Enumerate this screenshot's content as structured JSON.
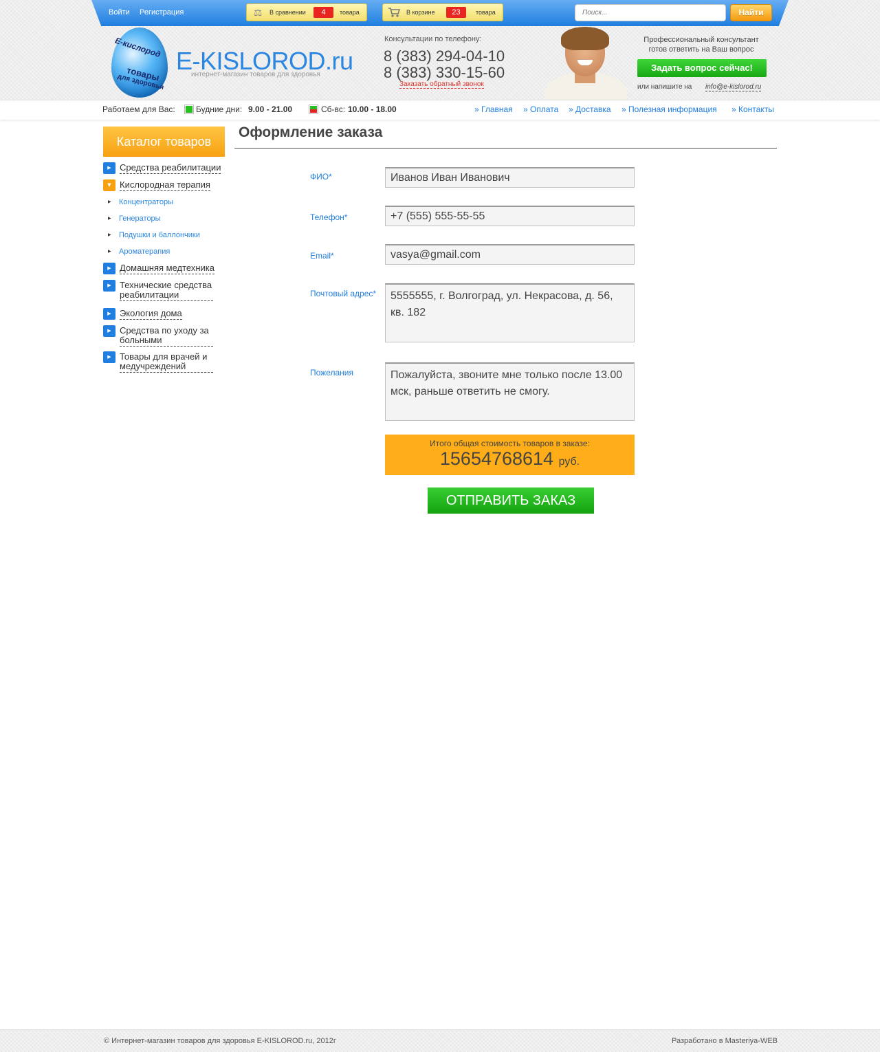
{
  "topbar": {
    "login": "Войти",
    "register": "Регистрация",
    "compare": {
      "label": "В сравнении",
      "count": "4",
      "suffix": "товара",
      "icon": "scales-icon"
    },
    "cart": {
      "label": "В корзине",
      "count": "23",
      "suffix": "товара",
      "icon": "cart-icon"
    },
    "search_placeholder": "Поиск...",
    "search_button": "Найти"
  },
  "header": {
    "logo": {
      "line1": "E-кислород",
      "line2": "товары",
      "line3": "для здоровья"
    },
    "brand": "E-KISLOROD.ru",
    "tagline": "интернет-магазин товаров для здоровья",
    "consult_title": "Консультации по телефону:",
    "phones": [
      "8 (383) 294-04-10",
      "8 (383) 330-15-60"
    ],
    "callback": "Заказать обратный звонок",
    "pro_line1": "Профессиональный консультант",
    "pro_line2": "готов ответить на Ваш вопрос",
    "ask_button": "Задать вопрос сейчас!",
    "write_label": "или напишите на",
    "email": "info@e-kislorod.ru"
  },
  "strip": {
    "working_label": "Работаем для Вас:",
    "weekdays_label": "Будние дни:",
    "weekdays_hours": "9.00 - 21.00",
    "weekend_label": "Сб-вс:",
    "weekend_hours": "10.00 - 18.00",
    "nav": [
      "» Главная",
      "» Оплата",
      "» Доставка",
      "» Полезная информация",
      "» Контакты"
    ]
  },
  "sidebar": {
    "title": "Каталог товаров",
    "items": [
      {
        "label": "Средства реабилитации"
      },
      {
        "label": "Кислородная терапия"
      },
      {
        "label": "Домашняя медтехника"
      },
      {
        "label": "Технические средства реабилитации"
      },
      {
        "label": "Экология дома"
      },
      {
        "label": "Средства по уходу за больными"
      },
      {
        "label": "Товары для врачей и медучреждений"
      }
    ],
    "subitems": [
      "Концентраторы",
      "Генераторы",
      "Подушки и баллончики",
      "Ароматерапия"
    ]
  },
  "main": {
    "title": "Оформление заказа",
    "fields": {
      "name": {
        "label": "ФИО*",
        "value": "Иванов Иван Иванович"
      },
      "phone": {
        "label": "Телефон*",
        "value": "+7 (555) 555-55-55"
      },
      "email": {
        "label": "Email*",
        "value": "vasya@gmail.com"
      },
      "address": {
        "label": "Почтовый адрес*",
        "value": "5555555, г. Волгоград, ул. Некрасова, д. 56, кв. 182"
      },
      "wishes": {
        "label": "Пожелания",
        "value": "Пожалуйста, звоните мне только после 13.00 мск, раньше ответить не смогу."
      }
    },
    "total_label": "Итого общая стоимость товаров в заказе:",
    "total_value": "15654768614",
    "total_currency": "руб.",
    "submit": "ОТПРАВИТЬ ЗАКАЗ"
  },
  "footer": {
    "copyright": "© Интернет-магазин товаров для здоровья E-KISLOROD.ru, 2012г",
    "developer": "Разработано в Masteriya-WEB"
  },
  "colors": {
    "accent_blue": "#1f7ee0",
    "orange": "#f7a111",
    "green": "#18a814",
    "badge_red": "#e8251f"
  }
}
